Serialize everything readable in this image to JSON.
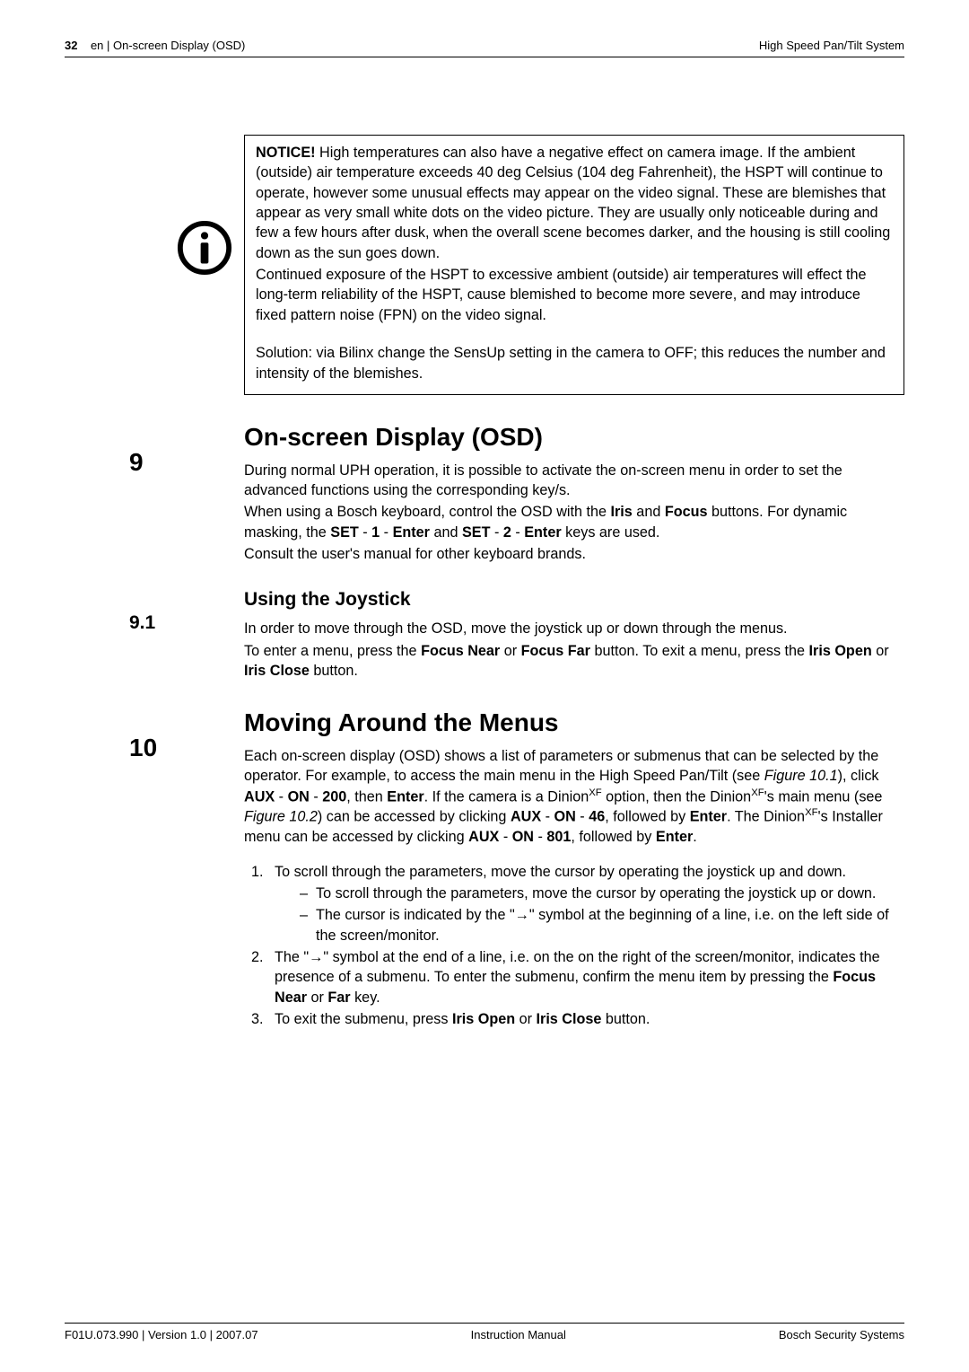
{
  "header": {
    "page_num": "32",
    "section": "en | On-screen Display (OSD)",
    "product": "High Speed Pan/Tilt System"
  },
  "notice": {
    "label": "NOTICE!",
    "p1a": " High temperatures can also have a negative effect on camera image. If the ambient (outside) air temperature exceeds 40 deg Celsius (104 deg Fahrenheit), the HSPT will continue to operate, however some unusual effects may appear on the video signal. These are blemishes that appear as very small white dots on the video picture. They are usually only noticeable during and few a few hours after dusk, when the overall scene becomes darker, and the housing is still cooling down as the sun goes down.",
    "p1b": "Continued exposure of the HSPT to excessive ambient (outside) air temperatures will effect the long-term reliability of the HSPT, cause blemished to become more severe, and may introduce fixed pattern noise (FPN) on the video signal.",
    "p2": "Solution: via Bilinx change the SensUp setting in the camera to OFF; this reduces the number and intensity of the blemishes."
  },
  "s9": {
    "num": "9",
    "title": "On-screen Display (OSD)",
    "p1": "During normal UPH operation, it is possible to activate the on-screen menu in order to set the advanced functions using the corresponding key/s.",
    "p2a": "When using a Bosch keyboard, control the OSD with the ",
    "p2b": " and ",
    "p2c": " buttons. For dynamic masking, the ",
    "p2d": " and ",
    "p2e": " keys are used.",
    "p3": "Consult the user's manual for other keyboard brands.",
    "kw_iris": "Iris",
    "kw_focus": "Focus",
    "kw_set": "SET",
    "kw_enter": "Enter",
    "kw_1": "1",
    "kw_2": "2"
  },
  "s9_1": {
    "num": "9.1",
    "title": "Using the Joystick",
    "p1": "In order to move through the OSD, move the joystick up or down through the menus.",
    "p2a": "To enter a menu, press the ",
    "p2b": " or ",
    "p2c": " button. To exit a menu, press the ",
    "p2d": " or ",
    "p2e": " button.",
    "kw_fn": "Focus Near",
    "kw_ff": "Focus Far",
    "kw_io": "Iris Open",
    "kw_ic": "Iris Close"
  },
  "s10": {
    "num": "10",
    "title": "Moving Around the Menus",
    "p1a": "Each on-screen display (OSD) shows a list of parameters or submenus that can be selected by the operator. For example, to access the main menu in the High Speed Pan/Tilt (see ",
    "fig1": "Figure 10.1",
    "p1b": "), click ",
    "p1c": ", then ",
    "p1d": ". If the camera is a Dinion",
    "p1e": " option, then the Dinion",
    "p1f": "'s main menu (see ",
    "fig2": "Figure 10.2",
    "p1g": ") can be accessed by clicking ",
    "p1h": ", followed by ",
    "p1i": ". The Dinion",
    "p1j": "'s Installer menu can be accessed by clicking ",
    "p1k": ", followed by ",
    "p1l": ".",
    "kw_aux": "AUX",
    "kw_on": "ON",
    "kw_200": "200",
    "kw_enter": "Enter",
    "kw_46": "46",
    "kw_801": "801",
    "xf": "XF",
    "step1": "To scroll through the parameters, move the cursor by operating the joystick up and down.",
    "step1a": "To scroll through the parameters, move the cursor by operating the joystick up or down.",
    "step1b": "The cursor is indicated by the \"→\" symbol at the beginning of a line, i.e. on the left side of the screen/monitor.",
    "step2a": "The \"→\" symbol at the end of a line, i.e. on the on the right of the screen/monitor, indicates the presence of a submenu. To enter the submenu, confirm the menu item by pressing the ",
    "step2b": " or ",
    "step2c": " key.",
    "kw_fn": "Focus Near",
    "kw_far": "Far",
    "step3a": "To exit the submenu, press ",
    "step3b": " or ",
    "step3c": " button.",
    "kw_io": "Iris Open",
    "kw_ic": "Iris Close"
  },
  "footer": {
    "left": "F01U.073.990 | Version 1.0 | 2007.07",
    "center": "Instruction Manual",
    "right": "Bosch Security Systems"
  }
}
